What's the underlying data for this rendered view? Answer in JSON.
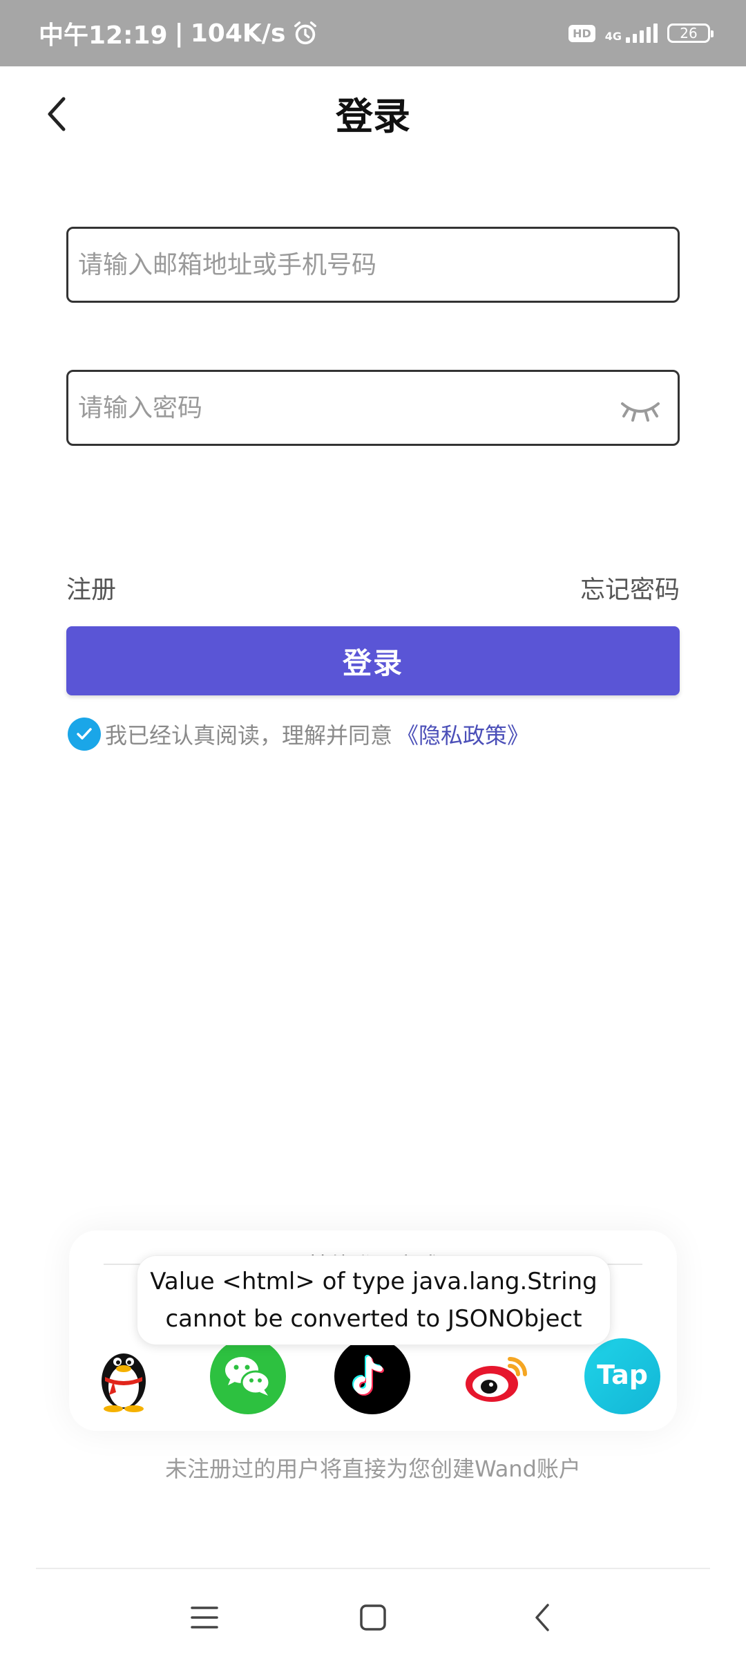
{
  "status_bar": {
    "time": "中午12:19",
    "separator": "|",
    "speed": "104K/s",
    "hd": "HD",
    "network": "4G",
    "battery": "26"
  },
  "header": {
    "title": "登录"
  },
  "form": {
    "account_placeholder": "请输入邮箱地址或手机号码",
    "password_placeholder": "请输入密码",
    "register_link": "注册",
    "forgot_link": "忘记密码",
    "login_button": "登录",
    "agree_text": "我已经认真阅读，理解并同意",
    "policy_link": "《隐私政策》",
    "agree_checked": true
  },
  "other_login": {
    "title": "其他登录方式",
    "providers": [
      "qq-icon",
      "wechat-icon",
      "tiktok-icon",
      "weibo-icon",
      "taptap-icon"
    ]
  },
  "toast": {
    "line1": "Value <html> of type java.lang.String",
    "line2": "cannot be converted to JSONObject"
  },
  "notice": "未注册过的用户将直接为您创建Wand账户",
  "colors": {
    "accent": "#5a55d6",
    "check": "#1aa6e8",
    "link": "#4b4fb8",
    "status_bar": "#a6a6a6"
  }
}
